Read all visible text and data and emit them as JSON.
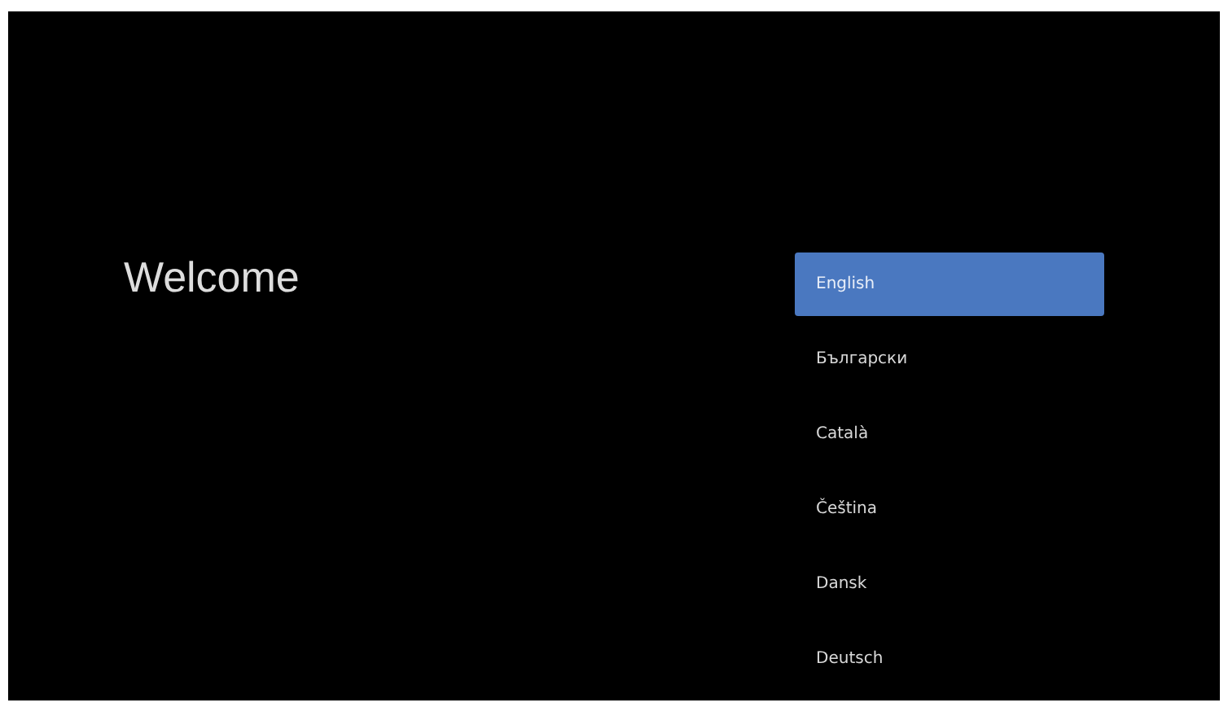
{
  "title": "Welcome",
  "languages": [
    {
      "label": "English",
      "selected": true
    },
    {
      "label": "Български",
      "selected": false
    },
    {
      "label": "Català",
      "selected": false
    },
    {
      "label": "Čeština",
      "selected": false
    },
    {
      "label": "Dansk",
      "selected": false
    },
    {
      "label": "Deutsch",
      "selected": false
    }
  ]
}
